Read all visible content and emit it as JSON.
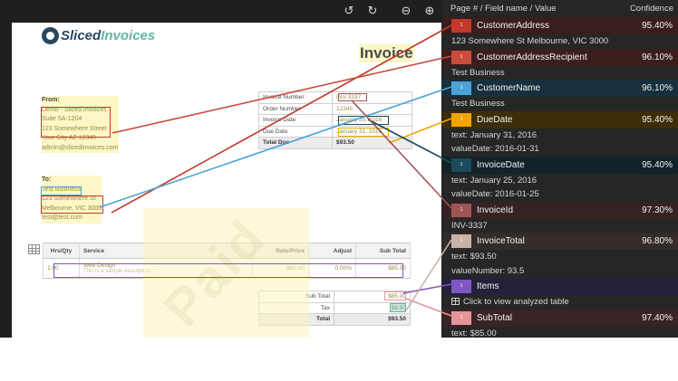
{
  "toolbar": {
    "rotate_left_icon": "rotate-ccw",
    "rotate_right_icon": "rotate-cw",
    "zoom_out_icon": "zoom-out",
    "zoom_in_icon": "zoom-in"
  },
  "document": {
    "logo_text_a": "Sliced",
    "logo_text_b": "Invoices",
    "title": "Invoice",
    "from": {
      "heading": "From:",
      "lines": [
        "Demo - Sliced Invoices",
        "Suite 5A-1204",
        "123 Somewhere Street",
        "Your City AZ 12345",
        "admin@slicedinvoices.com"
      ]
    },
    "to": {
      "heading": "To:",
      "lines": [
        "Test Business",
        "123 Somewhere St",
        "Melbourne, VIC 3000",
        "test@test.com"
      ]
    },
    "meta": [
      {
        "label": "Invoice Number",
        "value": "INV-3337"
      },
      {
        "label": "Order Number",
        "value": "12345"
      },
      {
        "label": "Invoice Date",
        "value": "January 25, 2016"
      },
      {
        "label": "Due Date",
        "value": "January 31, 2016"
      },
      {
        "label": "Total Due",
        "value": "$93.50"
      }
    ],
    "items_header": {
      "qty": "Hrs/Qty",
      "service": "Service",
      "rate": "Rate/Price",
      "adjust": "Adjust",
      "subtotal": "Sub Total"
    },
    "items": [
      {
        "qty": "1.00",
        "service": "Web Design",
        "desc": "This is a sample description...",
        "rate": "$85.00",
        "adjust": "0.00%",
        "subtotal": "$85.00"
      }
    ],
    "summary": [
      {
        "label": "Sub Total",
        "value": "$85.00"
      },
      {
        "label": "Tax",
        "value": "$8.50"
      },
      {
        "label": "Total",
        "value": "$93.50"
      }
    ],
    "stamp": "Paid"
  },
  "panel": {
    "header_left": "Page # / Field name / Value",
    "header_right": "Confidence",
    "table_link": "Click to view analyzed table",
    "fields": [
      {
        "page": "1",
        "name": "CustomerAddress",
        "confidence": "95.40%",
        "color": "#c0392b",
        "row_bg": "#3a1d1d",
        "values": [
          "123 Somewhere St Melbourne, VIC 3000"
        ]
      },
      {
        "page": "1",
        "name": "CustomerAddressRecipient",
        "confidence": "96.10%",
        "color": "#c94b3c",
        "row_bg": "#3b1f1c",
        "values": [
          "Test Business"
        ]
      },
      {
        "page": "1",
        "name": "CustomerName",
        "confidence": "96.10%",
        "color": "#4aa3d6",
        "row_bg": "#17303d",
        "values": [
          "Test Business"
        ]
      },
      {
        "page": "1",
        "name": "DueDate",
        "confidence": "95.40%",
        "color": "#f0a500",
        "row_bg": "#3d2e09",
        "values": [
          "text: January 31, 2016",
          "valueDate: 2016-01-31"
        ]
      },
      {
        "page": "1",
        "name": "InvoiceDate",
        "confidence": "95.40%",
        "color": "#1b4b5c",
        "row_bg": "#132228",
        "values": [
          "text: January 25, 2016",
          "valueDate: 2016-01-25"
        ]
      },
      {
        "page": "1",
        "name": "InvoiceId",
        "confidence": "97.30%",
        "color": "#a05555",
        "row_bg": "#352222",
        "values": [
          "INV-3337"
        ]
      },
      {
        "page": "1",
        "name": "InvoiceTotal",
        "confidence": "96.80%",
        "color": "#c9b2a6",
        "row_bg": "#332c29",
        "values": [
          "text: $93.50",
          "valueNumber: 93.5"
        ]
      },
      {
        "page": "1",
        "name": "Items",
        "confidence": "",
        "color": "#7e57c2",
        "row_bg": "#25203a",
        "values": []
      },
      {
        "page": "1",
        "name": "SubTotal",
        "confidence": "97.40%",
        "color": "#e8949b",
        "row_bg": "#3a2325",
        "values": [
          "text: $85.00"
        ]
      }
    ]
  }
}
